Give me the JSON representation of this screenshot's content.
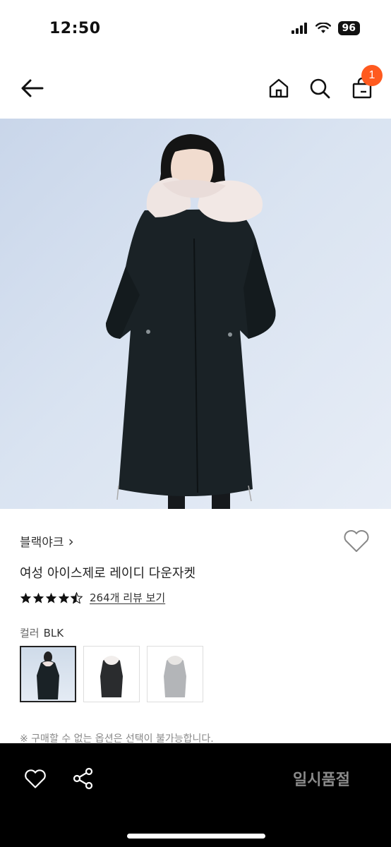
{
  "status": {
    "time": "12:50",
    "battery": "96"
  },
  "nav": {
    "cart_count": "1"
  },
  "product": {
    "brand": "블랙야크",
    "brand_chevron": "›",
    "name": "여성 아이스제로 레이디 다운자켓",
    "rating": 4.5,
    "review_link": "264개 리뷰 보기",
    "color_label": "컬러",
    "color_value": "BLK",
    "colors": [
      "BLK",
      "charcoal",
      "gray"
    ],
    "notice": "※ 구매할 수 없는 옵션은 선택이 불가능합니다."
  },
  "bottom": {
    "soldout_label": "일시품절"
  },
  "colors": {
    "accent": "#ff5a1f",
    "bottom_bg": "#000000",
    "soldout_text": "#8a8a8a"
  }
}
